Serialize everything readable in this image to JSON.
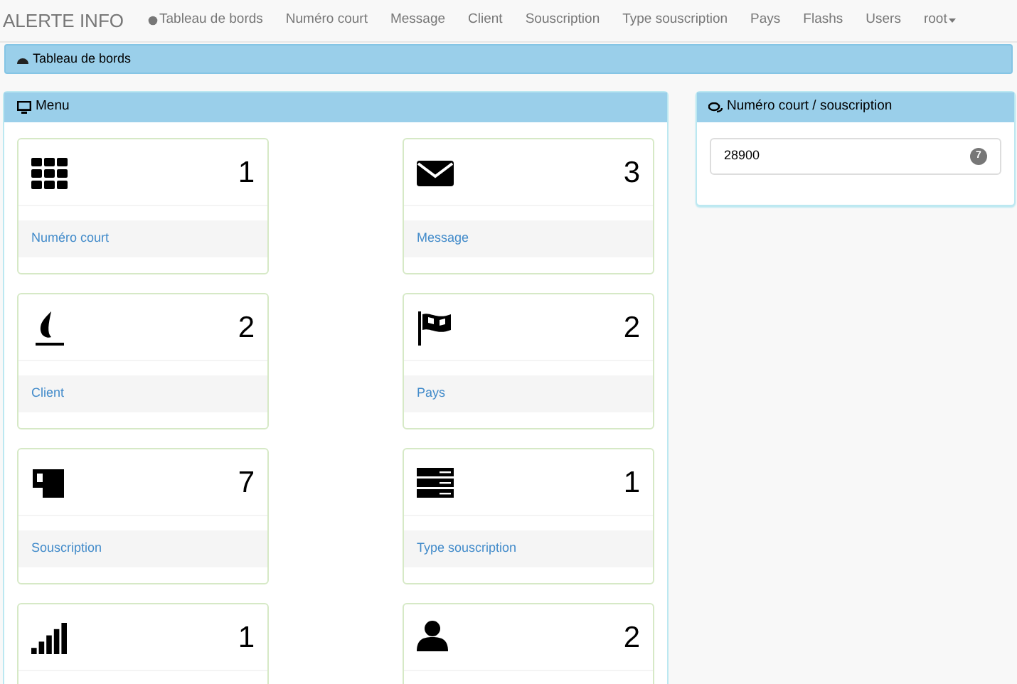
{
  "navbar": {
    "brand": "ALERTE INFO",
    "items": [
      "Tableau de bords",
      "Numéro court",
      "Message",
      "Client",
      "Souscription",
      "Type souscription",
      "Pays",
      "Flashs",
      "Users"
    ],
    "user_menu": "root"
  },
  "breadcrumb": "Tableau de bords",
  "menu_panel": {
    "title": "Menu",
    "cards": [
      {
        "count": "1",
        "label": "Numéro court"
      },
      {
        "count": "3",
        "label": "Message"
      },
      {
        "count": "2",
        "label": "Client"
      },
      {
        "count": "2",
        "label": "Pays"
      },
      {
        "count": "7",
        "label": "Souscription"
      },
      {
        "count": "1",
        "label": "Type souscription"
      },
      {
        "count": "1"
      },
      {
        "count": "2"
      }
    ]
  },
  "side_panel": {
    "title": "Numéro court / souscription",
    "items": [
      {
        "label": "28900",
        "badge": "7"
      }
    ]
  }
}
